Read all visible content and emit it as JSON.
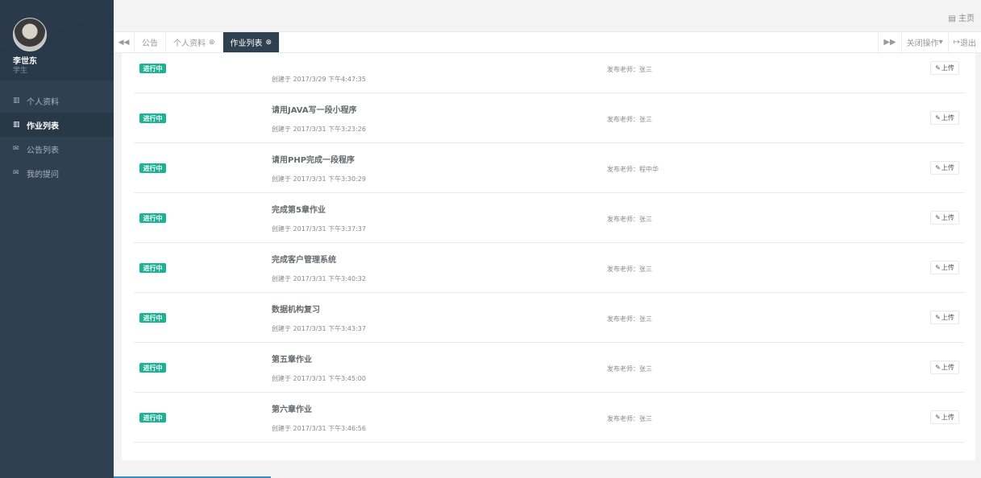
{
  "user": {
    "name": "李世东",
    "role": "学生"
  },
  "nav": [
    {
      "label": "个人资料",
      "icon": "bar-chart-icon",
      "glyph": "▥",
      "active": false
    },
    {
      "label": "作业列表",
      "icon": "bar-chart-icon",
      "glyph": "▥",
      "active": true
    },
    {
      "label": "公告列表",
      "icon": "envelope-icon",
      "glyph": "✉",
      "active": false
    },
    {
      "label": "我的提问",
      "icon": "envelope-icon",
      "glyph": "✉",
      "active": false
    }
  ],
  "header": {
    "home_icon": "▤",
    "home_label": "主页"
  },
  "tabs": {
    "back_icon": "◀◀",
    "forward_icon": "▶▶",
    "items": [
      {
        "label": "公告",
        "active": false,
        "close": ""
      },
      {
        "label": "个人资料",
        "active": false,
        "close": "⊗"
      },
      {
        "label": "作业列表",
        "active": true,
        "close": "⊗"
      }
    ],
    "close_ops_label": "关闭操作",
    "close_ops_caret": "▾",
    "logout_icon": "↦",
    "logout_label": "退出"
  },
  "assignments": {
    "status_label": "进行中",
    "upload_icon": "✎",
    "upload_label": "上传",
    "items": [
      {
        "title": "",
        "created": "创建于 2017/3/29 下午4:47:35",
        "teacher": "发布老师：张三"
      },
      {
        "title": "请用JAVA写一段小程序",
        "created": "创建于 2017/3/31 下午3:23:26",
        "teacher": "发布老师：张三"
      },
      {
        "title": "请用PHP完成一段程序",
        "created": "创建于 2017/3/31 下午3:30:29",
        "teacher": "发布老师：程中华"
      },
      {
        "title": "完成第5章作业",
        "created": "创建于 2017/3/31 下午3:37:37",
        "teacher": "发布老师：张三"
      },
      {
        "title": "完成客户管理系统",
        "created": "创建于 2017/3/31 下午3:40:32",
        "teacher": "发布老师：张三"
      },
      {
        "title": "数据机构复习",
        "created": "创建于 2017/3/31 下午3:43:37",
        "teacher": "发布老师：张三"
      },
      {
        "title": "第五章作业",
        "created": "创建于 2017/3/31 下午3:45:00",
        "teacher": "发布老师：张三"
      },
      {
        "title": "第六章作业",
        "created": "创建于 2017/3/31 下午3:46:56",
        "teacher": "发布老师：张三"
      }
    ]
  }
}
